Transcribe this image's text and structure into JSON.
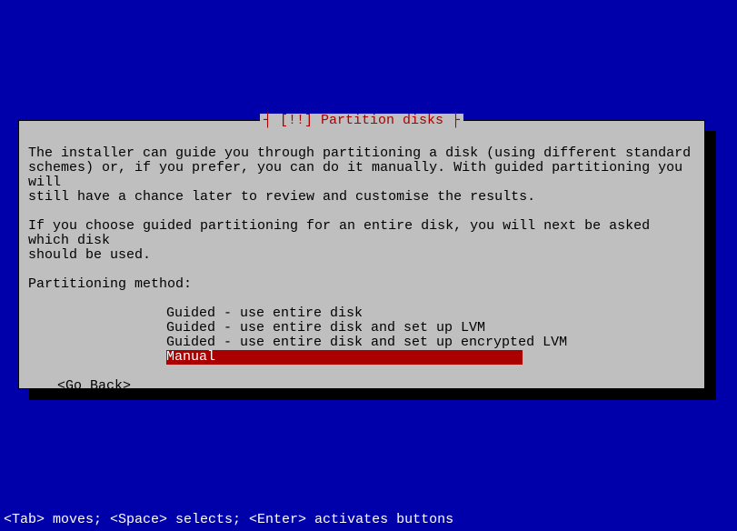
{
  "dialog": {
    "title": "┤ [!!] Partition disks ├",
    "paragraph1": "The installer can guide you through partitioning a disk (using different standard\nschemes) or, if you prefer, you can do it manually. With guided partitioning you will\nstill have a chance later to review and customise the results.",
    "paragraph2": "If you choose guided partitioning for an entire disk, you will next be asked which disk\nshould be used.",
    "prompt": "Partitioning method:",
    "options": {
      "opt0": "Guided - use entire disk",
      "opt1": "Guided - use entire disk and set up LVM",
      "opt2": "Guided - use entire disk and set up encrypted LVM",
      "opt3": "Manual"
    },
    "go_back": "<Go Back>"
  },
  "footer": "<Tab> moves; <Space> selects; <Enter> activates buttons"
}
